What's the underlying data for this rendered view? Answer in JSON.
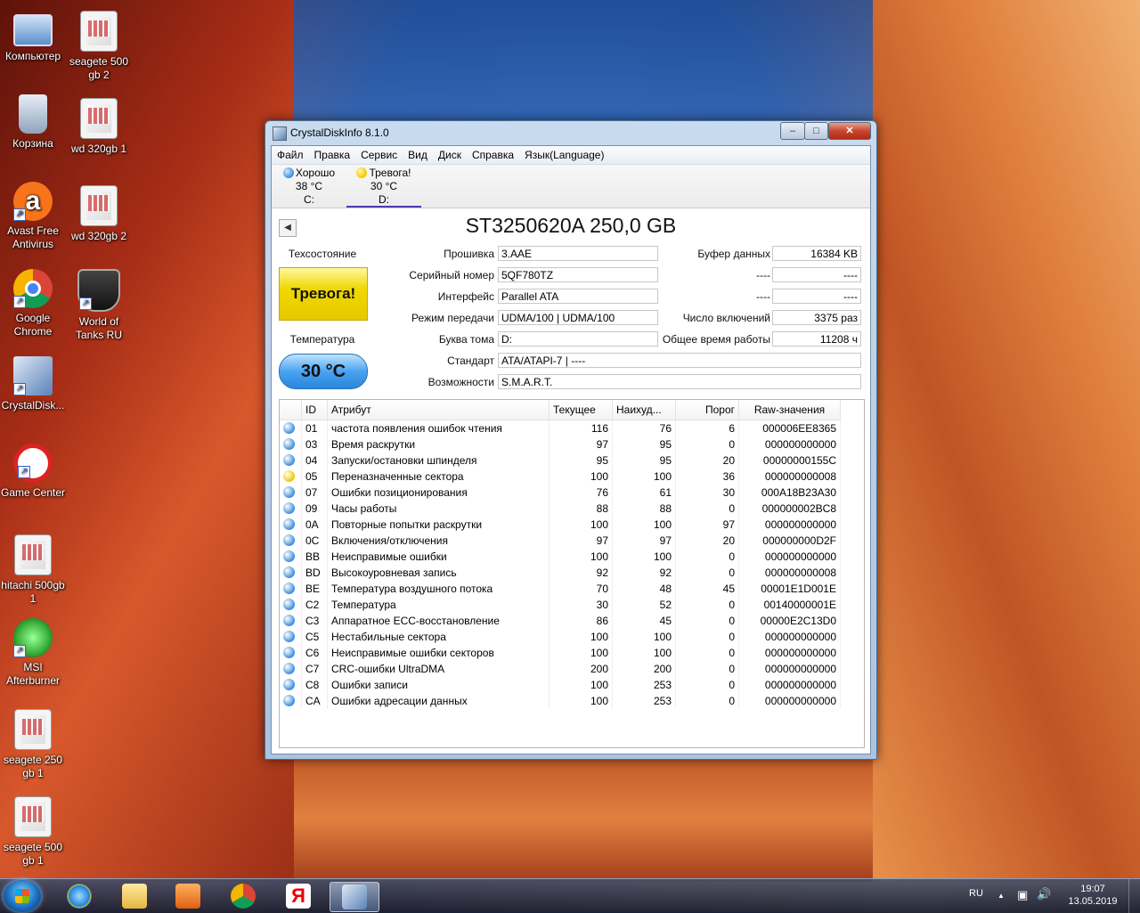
{
  "desktop": {
    "icons": [
      {
        "label": "Компьютер"
      },
      {
        "label": "seagete 500 gb 2"
      },
      {
        "label": "Корзина"
      },
      {
        "label": "wd 320gb 1"
      },
      {
        "label": "Avast Free Antivirus"
      },
      {
        "label": "wd 320gb 2"
      },
      {
        "label": "Google Chrome"
      },
      {
        "label": "World of Tanks RU"
      },
      {
        "label": "CrystalDisk..."
      },
      {
        "label": "Game Center"
      },
      {
        "label": "hitachi 500gb 1"
      },
      {
        "label": "MSI Afterburner"
      },
      {
        "label": "seagete 250 gb 1"
      },
      {
        "label": "seagete 500 gb 1"
      }
    ]
  },
  "window": {
    "title": "CrystalDiskInfo 8.1.0",
    "buttons": {
      "minimize": "–",
      "maximize": "□",
      "close": "✕"
    },
    "menu": [
      "Файл",
      "Правка",
      "Сервис",
      "Вид",
      "Диск",
      "Справка",
      "Язык(Language)"
    ],
    "disks": [
      {
        "status": "Хорошо",
        "temp": "38 °C",
        "letter": "C:",
        "color": "good"
      },
      {
        "status": "Тревога!",
        "temp": "30 °C",
        "letter": "D:",
        "color": "warn"
      }
    ],
    "nav_arrow": "◀",
    "model": "ST3250620A 250,0 GB",
    "health_label": "Техсостояние",
    "health_value": "Тревога!",
    "temp_label": "Температура",
    "temp_value": "30 °C",
    "fields": {
      "firmware": {
        "label": "Прошивка",
        "value": "3.AAE"
      },
      "serial": {
        "label": "Серийный номер",
        "value": "5QF780TZ"
      },
      "interface": {
        "label": "Интерфейс",
        "value": "Parallel ATA"
      },
      "transfer": {
        "label": "Режим передачи",
        "value": "UDMA/100 | UDMA/100"
      },
      "letter": {
        "label": "Буква тома",
        "value": "D:"
      },
      "standard": {
        "label": "Стандарт",
        "value": "ATA/ATAPI-7 | ----"
      },
      "features": {
        "label": "Возможности",
        "value": "S.M.A.R.T."
      },
      "buffer": {
        "label": "Буфер данных",
        "value": "16384 KB"
      },
      "blank1": {
        "label": "----",
        "value": "----"
      },
      "blank2": {
        "label": "----",
        "value": "----"
      },
      "power_count": {
        "label": "Число включений",
        "value": "3375 раз"
      },
      "power_hours": {
        "label": "Общее время работы",
        "value": "11208 ч"
      }
    },
    "smart_headers": [
      "ID",
      "Атрибут",
      "Текущее",
      "Наихуд...",
      "Порог",
      "Raw-значения"
    ],
    "smart_rows": [
      {
        "status": "good",
        "id": "01",
        "name": "частота появления ошибок чтения",
        "cur": "116",
        "worst": "76",
        "thr": "6",
        "raw": "000006EE8365"
      },
      {
        "status": "good",
        "id": "03",
        "name": "Время раскрутки",
        "cur": "97",
        "worst": "95",
        "thr": "0",
        "raw": "000000000000"
      },
      {
        "status": "good",
        "id": "04",
        "name": "Запуски/остановки шпинделя",
        "cur": "95",
        "worst": "95",
        "thr": "20",
        "raw": "00000000155C"
      },
      {
        "status": "warn",
        "id": "05",
        "name": "Переназначенные сектора",
        "cur": "100",
        "worst": "100",
        "thr": "36",
        "raw": "000000000008"
      },
      {
        "status": "good",
        "id": "07",
        "name": "Ошибки позиционирования",
        "cur": "76",
        "worst": "61",
        "thr": "30",
        "raw": "000A18B23A30"
      },
      {
        "status": "good",
        "id": "09",
        "name": "Часы работы",
        "cur": "88",
        "worst": "88",
        "thr": "0",
        "raw": "000000002BC8"
      },
      {
        "status": "good",
        "id": "0A",
        "name": "Повторные попытки раскрутки",
        "cur": "100",
        "worst": "100",
        "thr": "97",
        "raw": "000000000000"
      },
      {
        "status": "good",
        "id": "0C",
        "name": "Включения/отключения",
        "cur": "97",
        "worst": "97",
        "thr": "20",
        "raw": "000000000D2F"
      },
      {
        "status": "good",
        "id": "BB",
        "name": "Неисправимые ошибки",
        "cur": "100",
        "worst": "100",
        "thr": "0",
        "raw": "000000000000"
      },
      {
        "status": "good",
        "id": "BD",
        "name": "Высокоуровневая запись",
        "cur": "92",
        "worst": "92",
        "thr": "0",
        "raw": "000000000008"
      },
      {
        "status": "good",
        "id": "BE",
        "name": "Температура воздушного потока",
        "cur": "70",
        "worst": "48",
        "thr": "45",
        "raw": "00001E1D001E"
      },
      {
        "status": "good",
        "id": "C2",
        "name": "Температура",
        "cur": "30",
        "worst": "52",
        "thr": "0",
        "raw": "00140000001E"
      },
      {
        "status": "good",
        "id": "C3",
        "name": "Аппаратное ECC-восстановление",
        "cur": "86",
        "worst": "45",
        "thr": "0",
        "raw": "00000E2C13D0"
      },
      {
        "status": "good",
        "id": "C5",
        "name": "Нестабильные сектора",
        "cur": "100",
        "worst": "100",
        "thr": "0",
        "raw": "000000000000"
      },
      {
        "status": "good",
        "id": "C6",
        "name": "Неисправимые ошибки секторов",
        "cur": "100",
        "worst": "100",
        "thr": "0",
        "raw": "000000000000"
      },
      {
        "status": "good",
        "id": "C7",
        "name": "CRC-ошибки UltraDMA",
        "cur": "200",
        "worst": "200",
        "thr": "0",
        "raw": "000000000000"
      },
      {
        "status": "good",
        "id": "C8",
        "name": "Ошибки записи",
        "cur": "100",
        "worst": "253",
        "thr": "0",
        "raw": "000000000000"
      },
      {
        "status": "good",
        "id": "CA",
        "name": "Ошибки адресации данных",
        "cur": "100",
        "worst": "253",
        "thr": "0",
        "raw": "000000000000"
      }
    ]
  },
  "taskbar": {
    "lang": "RU",
    "time": "19:07",
    "date": "13.05.2019",
    "tray_arrow": "▲",
    "volume_icon": "🔊",
    "network_icon": "▣"
  },
  "colors": {
    "good": "#3a8ee0",
    "warn": "#f0c800",
    "titlebar": "#c9dbef"
  }
}
